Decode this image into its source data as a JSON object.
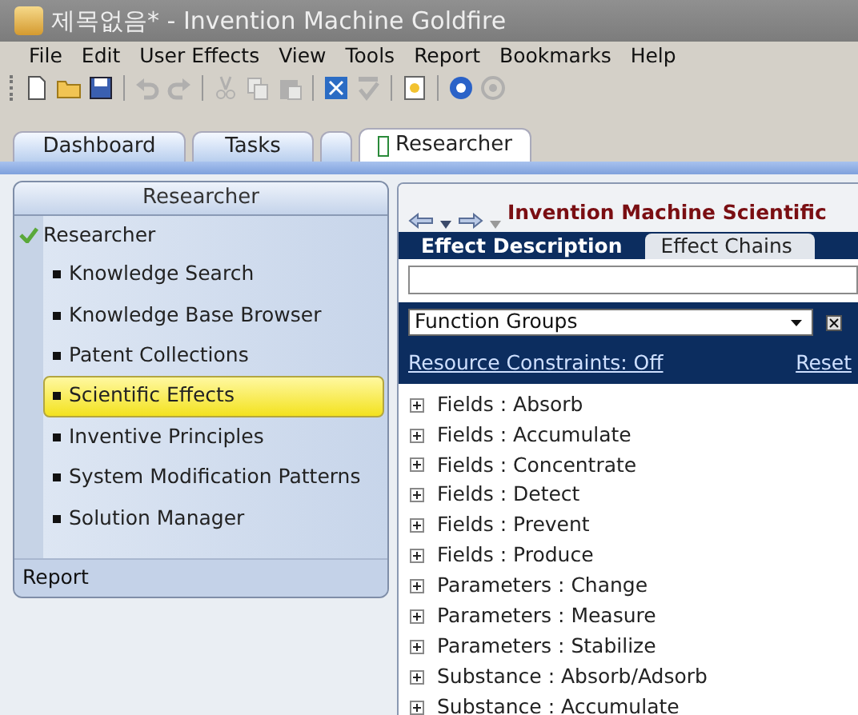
{
  "window": {
    "title": "제목없음* - Invention Machine Goldfire"
  },
  "menu": [
    "File",
    "Edit",
    "User Effects",
    "View",
    "Tools",
    "Report",
    "Bookmarks",
    "Help"
  ],
  "toolbar": [
    [
      {
        "kind": "new",
        "disabled": false
      },
      {
        "kind": "open",
        "disabled": false
      },
      {
        "kind": "save",
        "disabled": false
      }
    ],
    [
      {
        "kind": "undo",
        "disabled": true
      },
      {
        "kind": "redo",
        "disabled": true
      }
    ],
    [
      {
        "kind": "cut",
        "disabled": true
      },
      {
        "kind": "copy",
        "disabled": true
      },
      {
        "kind": "paste",
        "disabled": true
      }
    ],
    [
      {
        "kind": "fit",
        "disabled": false
      },
      {
        "kind": "spell",
        "disabled": true
      }
    ],
    [
      {
        "kind": "report",
        "disabled": false
      }
    ],
    [
      {
        "kind": "help",
        "disabled": false
      },
      {
        "kind": "circle",
        "disabled": true
      }
    ]
  ],
  "tabs": [
    {
      "label": "Dashboard",
      "selected": false
    },
    {
      "label": "Tasks",
      "selected": false
    },
    {
      "selected": false
    },
    {
      "label": "Researcher",
      "selected": true,
      "icon": true
    }
  ],
  "sidebar": {
    "header": "Researcher",
    "sections": [
      {
        "title": "Researcher",
        "checked": true,
        "items": [
          {
            "label": "Knowledge Search",
            "selected": false
          },
          {
            "label": "Knowledge Base Browser",
            "selected": false
          },
          {
            "label": "Patent Collections",
            "selected": false
          },
          {
            "label": "Scientific Effects",
            "selected": true
          },
          {
            "label": "Inventive Principles",
            "selected": false
          },
          {
            "label": "System Modification Patterns",
            "selected": false
          },
          {
            "label": "Solution Manager",
            "selected": false
          }
        ]
      },
      {
        "title": "Report",
        "checked": false
      }
    ]
  },
  "content": {
    "title": "Invention Machine Scientific",
    "tabs": [
      {
        "label": "Effect Description",
        "selected": true
      },
      {
        "label": "Effect Chains",
        "selected": false
      }
    ],
    "filter": {
      "value": "Function Groups",
      "constraints_link": "Resource Constraints: Off",
      "reset_link": "Reset"
    },
    "tree": [
      {
        "label": "Fields : Absorb",
        "expanded": false
      },
      {
        "label": "Fields : Accumulate",
        "expanded": false
      },
      {
        "label": "Fields : Concentrate",
        "expanded": false
      },
      {
        "label": "Fields : Detect",
        "expanded": false
      },
      {
        "label": "Fields : Prevent",
        "expanded": false
      },
      {
        "label": "Fields : Produce",
        "expanded": false
      },
      {
        "label": "Parameters : Change",
        "expanded": false
      },
      {
        "label": "Parameters : Measure",
        "expanded": false
      },
      {
        "label": "Parameters : Stabilize",
        "expanded": false
      },
      {
        "label": "Substance : Absorb/Adsorb",
        "expanded": false
      },
      {
        "label": "Substance : Accumulate",
        "expanded": false
      }
    ]
  }
}
